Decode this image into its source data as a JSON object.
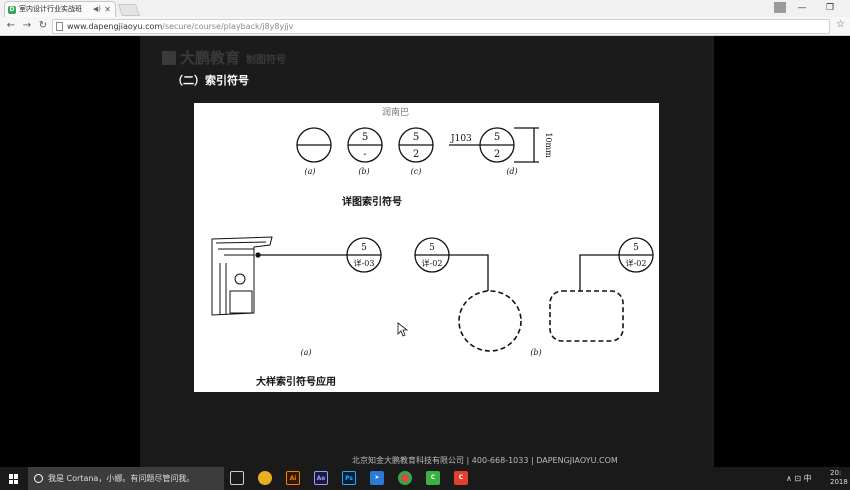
{
  "browser": {
    "tab_title": "室内设计行业实战班",
    "tab_audio": "◀)",
    "tab_close": "✕",
    "url_host": "www.dapengjiaoyu.com",
    "url_path": "/secure/course/playback/j8y8yjjv",
    "window_minimize": "—",
    "window_restore": "❐"
  },
  "slide": {
    "brand_name": "大鹏教育",
    "brand_sub": "制图符号",
    "heading": "（二）索引符号",
    "footer": "北京知金大鹏教育科技有限公司  |  400-668-1033  |  DAPENGJIAOYU.COM"
  },
  "figure": {
    "top_labels": [
      "(a)",
      "(b)",
      "(c)",
      "(d)"
    ],
    "sym_b_top": "5",
    "sym_b_bottom": "-",
    "sym_c_top": "5",
    "sym_c_bottom": "2",
    "sym_d_prefix": "J103",
    "sym_d_top": "5",
    "sym_d_bottom": "2",
    "dim_label": "10mm",
    "caption_top": "详图索引符号",
    "bottom_sym1_top": "5",
    "bottom_sym1_bottom": "详-03",
    "bottom_sym2_top": "5",
    "bottom_sym2_bottom": "详-02",
    "bottom_sym3_top": "5",
    "bottom_sym3_bottom": "详-02",
    "bottom_labels": [
      "(a)",
      "(b)"
    ],
    "caption_bottom": "大样索引符号应用",
    "watermark": "润南巴"
  },
  "taskbar": {
    "cortana_text": "我是 Cortana，小娜。有问题尽管问我。",
    "tray_text": "∧ ⊡ 中",
    "clock_time": "20:",
    "clock_date": "2018"
  },
  "colors": {
    "brand_green": "#2fa84f",
    "illustrator": "#ff7c00",
    "aftereffects": "#9999ff",
    "photoshop": "#31a8ff"
  }
}
